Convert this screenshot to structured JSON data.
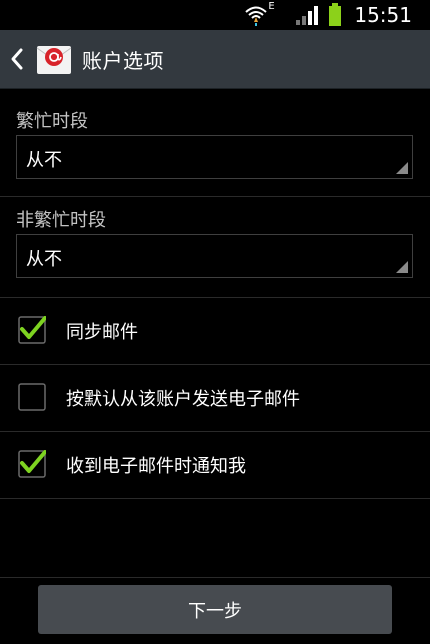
{
  "status_bar": {
    "time": "15:51",
    "network_type": "E",
    "icons": [
      "wifi-icon",
      "signal-icon",
      "battery-icon"
    ]
  },
  "app_bar": {
    "title": "账户选项",
    "icons": [
      "back-arrow-icon",
      "email-app-icon"
    ]
  },
  "settings": {
    "peak_label": "繁忙时段",
    "peak_value": "从不",
    "offpeak_label": "非繁忙时段",
    "offpeak_value": "从不"
  },
  "options": [
    {
      "label": "同步邮件",
      "checked": true
    },
    {
      "label": "按默认从该账户发送电子邮件",
      "checked": false
    },
    {
      "label": "收到电子邮件时通知我",
      "checked": true
    }
  ],
  "footer": {
    "next_label": "下一步"
  },
  "colors": {
    "check_green": "#7ed321",
    "app_bar": "#33393f",
    "button": "#474b50",
    "battery": "#8cd11a"
  }
}
